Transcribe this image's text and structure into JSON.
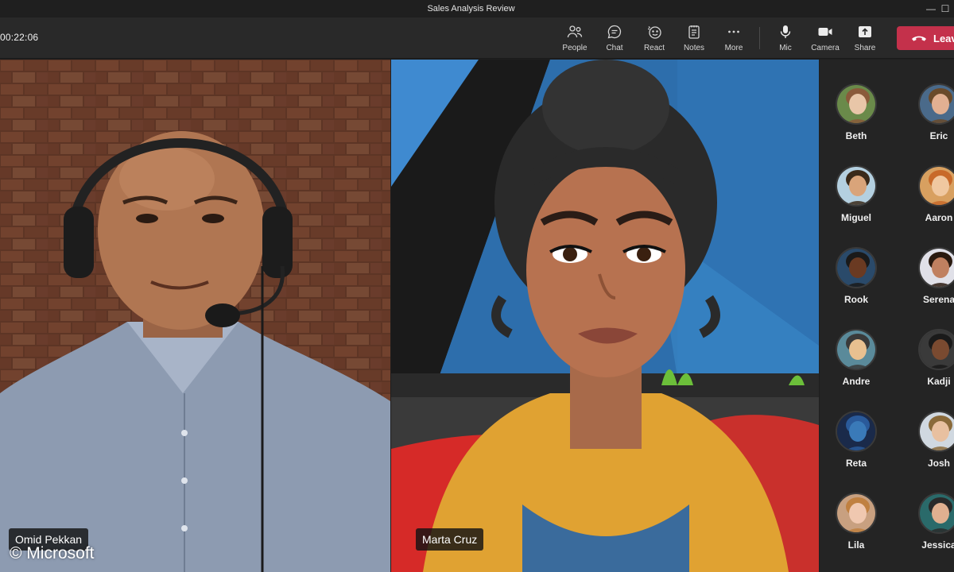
{
  "window": {
    "title": "Sales Analysis Review"
  },
  "call": {
    "elapsed": "00:22:06"
  },
  "toolbar": {
    "people": "People",
    "chat": "Chat",
    "react": "React",
    "notes": "Notes",
    "more": "More",
    "mic": "Mic",
    "camera": "Camera",
    "share": "Share",
    "leave": "Leave"
  },
  "stage": {
    "tiles": [
      {
        "name": "Omid Pekkan"
      },
      {
        "name": "Marta Cruz"
      }
    ],
    "watermark": "© Microsoft"
  },
  "participants": [
    {
      "name": "Beth"
    },
    {
      "name": "Eric"
    },
    {
      "name": "Miguel"
    },
    {
      "name": "Aaron"
    },
    {
      "name": "Rook"
    },
    {
      "name": "Serena"
    },
    {
      "name": "Andre"
    },
    {
      "name": "Kadji"
    },
    {
      "name": "Reta"
    },
    {
      "name": "Josh"
    },
    {
      "name": "Lila"
    },
    {
      "name": "Jessica"
    }
  ],
  "colors": {
    "leave": "#c4314b",
    "panel": "#242424",
    "toolbar": "#292929"
  }
}
